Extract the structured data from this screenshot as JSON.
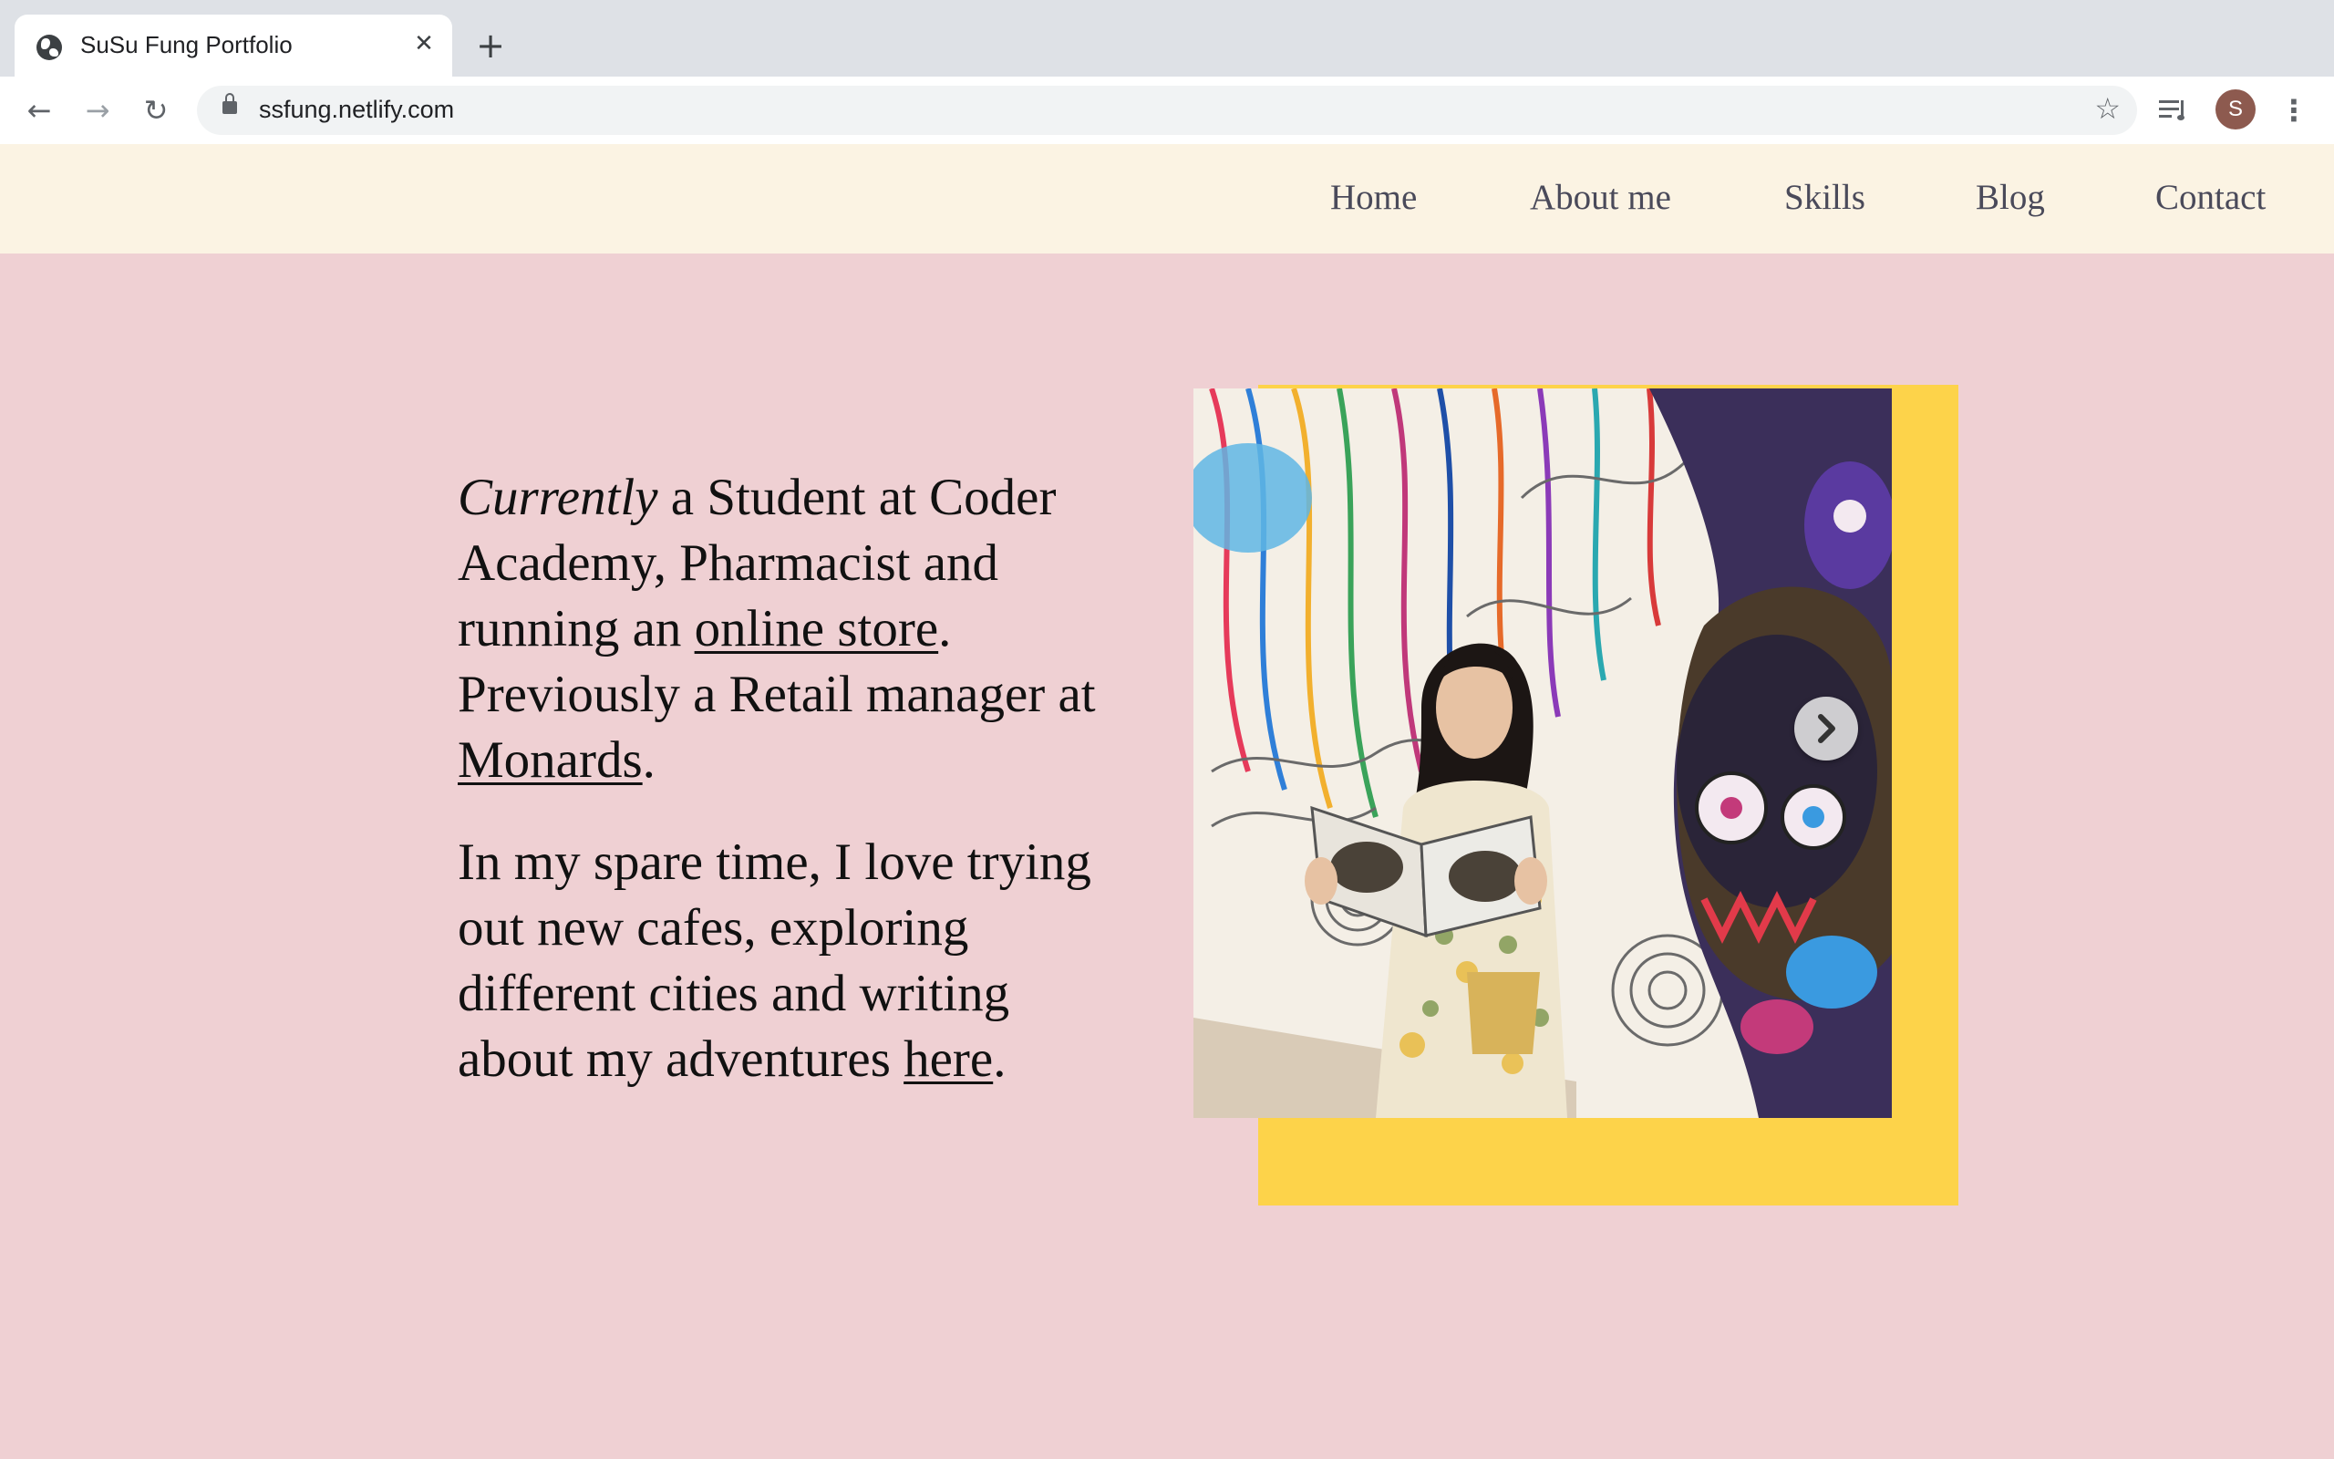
{
  "browser": {
    "tab_title": "SuSu Fung Portfolio",
    "tab_close": "✕",
    "new_tab": "+",
    "url": "ssfung.netlify.com",
    "back": "←",
    "forward": "→",
    "reload": "↻",
    "bookmark": "☆",
    "profile_initial": "S",
    "menu": "⋮"
  },
  "nav": {
    "items": [
      "Home",
      "About me",
      "Skills",
      "Blog",
      "Contact"
    ]
  },
  "hero": {
    "p1_em": "Currently",
    "p1_a": " a Student at Coder Academy, Pharmacist and running an ",
    "p1_link1": "online store",
    "p1_b": ". Previously a Retail manager at ",
    "p1_link2": "Monards",
    "p1_c": ".",
    "p2_a": "In my spare time, I love trying out new cafes, exploring different cities and writing about my adventures ",
    "p2_link": "here",
    "p2_b": "."
  },
  "colors": {
    "page_bg": "#efd0d3",
    "nav_bg": "#fbf3e3",
    "accent_frame": "#fdd34a",
    "nav_text": "#4a4a5a"
  }
}
